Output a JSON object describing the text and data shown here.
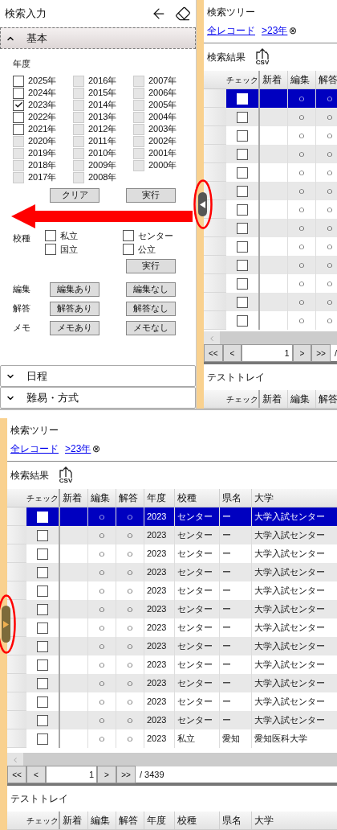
{
  "search_panel": {
    "title": "検索入力",
    "sections": [
      {
        "title": "基本",
        "expanded": true
      },
      {
        "title": "日程",
        "expanded": false
      },
      {
        "title": "難易・方式",
        "expanded": false
      }
    ],
    "year_label": "年度",
    "years": [
      {
        "label": "2025年",
        "checked": false,
        "disabled": false
      },
      {
        "label": "2024年",
        "checked": false,
        "disabled": false
      },
      {
        "label": "2023年",
        "checked": true,
        "disabled": false
      },
      {
        "label": "2022年",
        "checked": false,
        "disabled": false
      },
      {
        "label": "2021年",
        "checked": false,
        "disabled": false
      },
      {
        "label": "2020年",
        "checked": false,
        "disabled": true
      },
      {
        "label": "2019年",
        "checked": false,
        "disabled": true
      },
      {
        "label": "2018年",
        "checked": false,
        "disabled": true
      },
      {
        "label": "2017年",
        "checked": false,
        "disabled": true
      },
      {
        "label": "2016年",
        "checked": false,
        "disabled": true
      },
      {
        "label": "2015年",
        "checked": false,
        "disabled": true
      },
      {
        "label": "2014年",
        "checked": false,
        "disabled": true
      },
      {
        "label": "2013年",
        "checked": false,
        "disabled": true
      },
      {
        "label": "2012年",
        "checked": false,
        "disabled": true
      },
      {
        "label": "2011年",
        "checked": false,
        "disabled": true
      },
      {
        "label": "2010年",
        "checked": false,
        "disabled": true
      },
      {
        "label": "2009年",
        "checked": false,
        "disabled": true
      },
      {
        "label": "2008年",
        "checked": false,
        "disabled": true
      },
      {
        "label": "2007年",
        "checked": false,
        "disabled": true
      },
      {
        "label": "2006年",
        "checked": false,
        "disabled": true
      },
      {
        "label": "2005年",
        "checked": false,
        "disabled": true
      },
      {
        "label": "2004年",
        "checked": false,
        "disabled": true
      },
      {
        "label": "2003年",
        "checked": false,
        "disabled": true
      },
      {
        "label": "2002年",
        "checked": false,
        "disabled": true
      },
      {
        "label": "2001年",
        "checked": false,
        "disabled": true
      },
      {
        "label": "2000年",
        "checked": false,
        "disabled": true
      }
    ],
    "year_buttons": [
      "クリア",
      "実行"
    ],
    "school_type": {
      "label": "校種",
      "options": [
        {
          "label": "私立",
          "checked": false
        },
        {
          "label": "センター",
          "checked": false
        },
        {
          "label": "国立",
          "checked": false
        },
        {
          "label": "公立",
          "checked": false
        }
      ],
      "button": "実行"
    },
    "filters": [
      {
        "label": "編集",
        "buttons": [
          "編集あり",
          "編集なし"
        ]
      },
      {
        "label": "解答",
        "buttons": [
          "解答あり",
          "解答なし"
        ]
      },
      {
        "label": "メモ",
        "buttons": [
          "メモあり",
          "メモなし"
        ]
      }
    ]
  },
  "top_results": {
    "collapsed": false,
    "tree_title": "検索ツリー",
    "breadcrumbs": [
      {
        "label": "全レコード"
      },
      {
        "label": ">23年",
        "clear": "⊗"
      }
    ],
    "results_title": "検索結果",
    "csv": "CSV",
    "check_column": "チェック",
    "columns": [
      "新着",
      "編集",
      "解答"
    ],
    "rows": [
      {
        "selected": true,
        "checked": false,
        "cells": [
          "",
          "○",
          "○"
        ]
      },
      {
        "selected": false,
        "checked": false,
        "cells": [
          "",
          "○",
          "○"
        ]
      },
      {
        "selected": false,
        "checked": false,
        "cells": [
          "",
          "○",
          "○"
        ]
      },
      {
        "selected": false,
        "checked": false,
        "cells": [
          "",
          "○",
          "○"
        ]
      },
      {
        "selected": false,
        "checked": false,
        "cells": [
          "",
          "○",
          "○"
        ]
      },
      {
        "selected": false,
        "checked": false,
        "cells": [
          "",
          "○",
          "○"
        ]
      },
      {
        "selected": false,
        "checked": false,
        "cells": [
          "",
          "○",
          "○"
        ]
      },
      {
        "selected": false,
        "checked": false,
        "cells": [
          "",
          "○",
          "○"
        ]
      },
      {
        "selected": false,
        "checked": false,
        "cells": [
          "",
          "○",
          "○"
        ]
      },
      {
        "selected": false,
        "checked": false,
        "cells": [
          "",
          "○",
          "○"
        ]
      },
      {
        "selected": false,
        "checked": false,
        "cells": [
          "",
          "○",
          "○"
        ]
      },
      {
        "selected": false,
        "checked": false,
        "cells": [
          "",
          "○",
          "○"
        ]
      },
      {
        "selected": false,
        "checked": false,
        "cells": [
          "",
          "○",
          "○"
        ]
      }
    ],
    "pager": {
      "first": "<<",
      "prev": "<",
      "page": "1",
      "next": ">",
      "last": ">>",
      "total": "/"
    },
    "tray_title": "テストトレイ",
    "tray_check_column": "チェック",
    "tray_columns": [
      "新着",
      "編集",
      "解答"
    ]
  },
  "bottom_results": {
    "collapsed": true,
    "tree_title": "検索ツリー",
    "breadcrumbs": [
      {
        "label": "全レコード"
      },
      {
        "label": ">23年",
        "clear": "⊗"
      }
    ],
    "results_title": "検索結果",
    "csv": "CSV",
    "check_column": "チェック",
    "columns": [
      "新着",
      "編集",
      "解答",
      "年度",
      "校種",
      "県名",
      "大学"
    ],
    "rows": [
      {
        "selected": true,
        "checked": false,
        "cells": [
          "",
          "○",
          "○",
          "2023",
          "センター",
          "ー",
          "大学入試センター"
        ]
      },
      {
        "selected": false,
        "checked": false,
        "cells": [
          "",
          "○",
          "○",
          "2023",
          "センター",
          "ー",
          "大学入試センター"
        ]
      },
      {
        "selected": false,
        "checked": false,
        "cells": [
          "",
          "○",
          "○",
          "2023",
          "センター",
          "ー",
          "大学入試センター"
        ]
      },
      {
        "selected": false,
        "checked": false,
        "cells": [
          "",
          "○",
          "○",
          "2023",
          "センター",
          "ー",
          "大学入試センター"
        ]
      },
      {
        "selected": false,
        "checked": false,
        "cells": [
          "",
          "○",
          "○",
          "2023",
          "センター",
          "ー",
          "大学入試センター"
        ]
      },
      {
        "selected": false,
        "checked": false,
        "cells": [
          "",
          "○",
          "○",
          "2023",
          "センター",
          "ー",
          "大学入試センター"
        ]
      },
      {
        "selected": false,
        "checked": false,
        "cells": [
          "",
          "○",
          "○",
          "2023",
          "センター",
          "ー",
          "大学入試センター"
        ]
      },
      {
        "selected": false,
        "checked": false,
        "cells": [
          "",
          "○",
          "○",
          "2023",
          "センター",
          "ー",
          "大学入試センター"
        ]
      },
      {
        "selected": false,
        "checked": false,
        "cells": [
          "",
          "○",
          "○",
          "2023",
          "センター",
          "ー",
          "大学入試センター"
        ]
      },
      {
        "selected": false,
        "checked": false,
        "cells": [
          "",
          "○",
          "○",
          "2023",
          "センター",
          "ー",
          "大学入試センター"
        ]
      },
      {
        "selected": false,
        "checked": false,
        "cells": [
          "",
          "○",
          "○",
          "2023",
          "センター",
          "ー",
          "大学入試センター"
        ]
      },
      {
        "selected": false,
        "checked": false,
        "cells": [
          "",
          "○",
          "○",
          "2023",
          "センター",
          "ー",
          "大学入試センター"
        ]
      },
      {
        "selected": false,
        "checked": false,
        "cells": [
          "",
          "○",
          "○",
          "2023",
          "私立",
          "愛知",
          "愛知医科大学"
        ]
      }
    ],
    "pager": {
      "first": "<<",
      "prev": "<",
      "page": "1",
      "next": ">",
      "last": ">>",
      "total": "/ 3439"
    },
    "tray_title": "テストトレイ",
    "tray_check_column": "チェック",
    "tray_columns": [
      "新着",
      "編集",
      "解答",
      "年度",
      "校種",
      "県名",
      "大学"
    ]
  }
}
